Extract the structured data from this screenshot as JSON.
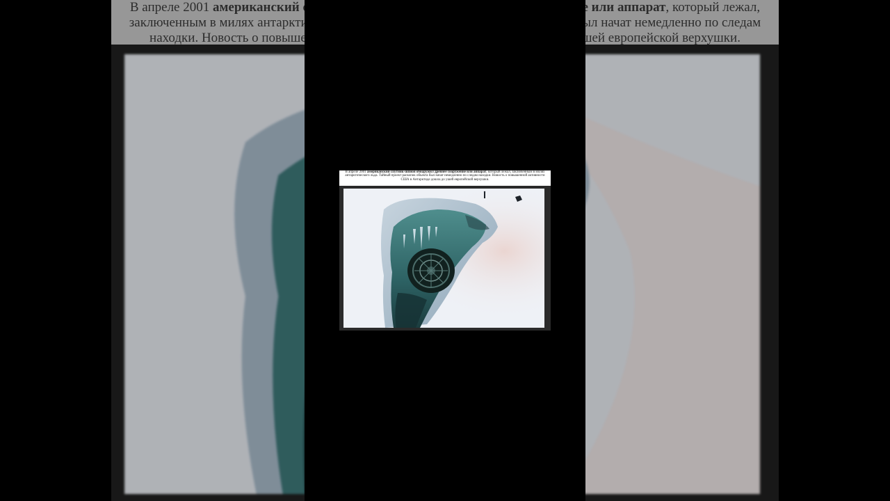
{
  "caption": {
    "line_prefix": "В апреле 2001 ",
    "bold_phrase": "американский спутник-шпион обнаружил древнее сооружение или аппарат",
    "rest": ", который лежал, заключенным в  милях антарктического льда. Тайный проект раскопок объекта был начат немедленно по следам находки. Новость о повышенной активности США в Антарктиде дошла до ушей европейской верхушки."
  },
  "photo": {
    "description_icon": "ice-crevasse-photo",
    "colors": {
      "snow": "#eef1f6",
      "ice_shadow": "#9fb3c4",
      "crevasse": "#2f6466",
      "deep_crevasse": "#173638",
      "pink_snow": "#e9d3cf"
    }
  }
}
